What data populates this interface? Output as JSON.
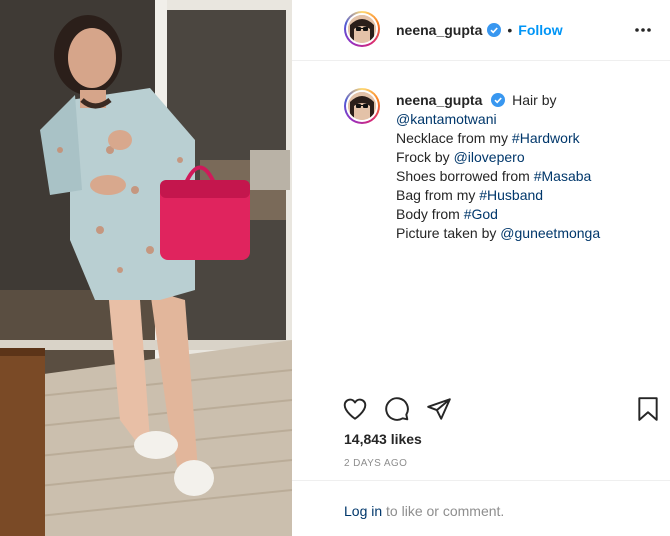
{
  "post": {
    "username": "neena_gupta",
    "follow_label": "Follow",
    "separator": "•",
    "caption_lines": [
      [
        {
          "t": "Hair by",
          "link": false
        }
      ],
      [
        {
          "t": "@kantamotwani",
          "link": true
        }
      ],
      [
        {
          "t": "Necklace from my ",
          "link": false
        },
        {
          "t": "#Hardwork",
          "link": true
        }
      ],
      [
        {
          "t": "Frock by ",
          "link": false
        },
        {
          "t": "@ilovepero",
          "link": true
        }
      ],
      [
        {
          "t": "Shoes borrowed from ",
          "link": false
        },
        {
          "t": "#Masaba",
          "link": true
        }
      ],
      [
        {
          "t": "Bag from my ",
          "link": false
        },
        {
          "t": "#Husband",
          "link": true
        }
      ],
      [
        {
          "t": "Body from ",
          "link": false
        },
        {
          "t": "#God",
          "link": true
        }
      ],
      [
        {
          "t": "Picture taken by ",
          "link": false
        },
        {
          "t": "@guneetmonga",
          "link": true
        }
      ]
    ],
    "likes": "14,843 likes",
    "timestamp": "2 DAYS AGO",
    "login_prompt": {
      "link": "Log in",
      "rest": " to like or comment."
    }
  },
  "icons": {
    "verified": "verified-badge-icon",
    "more": "more-options-icon",
    "like": "heart-icon",
    "comment": "comment-icon",
    "share": "share-icon",
    "save": "bookmark-icon"
  },
  "colors": {
    "accent": "#0095f6",
    "link": "#00376b",
    "muted": "#8e8e8e",
    "text": "#262626",
    "bag": "#e0245e"
  }
}
